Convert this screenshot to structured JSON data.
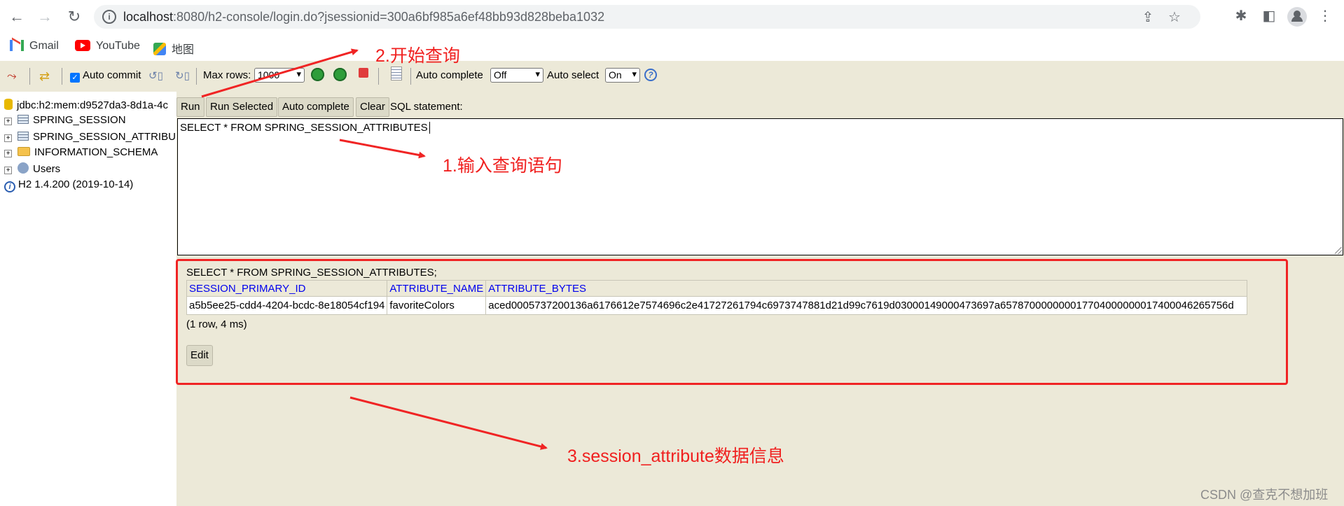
{
  "browser": {
    "url_host": "localhost",
    "url_rest": ":8080/h2-console/login.do?jsessionid=300a6bf985a6ef48bb93d828beba1032",
    "icons": [
      "back-icon",
      "forward-icon",
      "reload-icon",
      "info-icon",
      "share-icon",
      "star-icon",
      "extensions-icon",
      "sidebar-icon",
      "profile-icon",
      "menu-icon"
    ]
  },
  "bookmarks": [
    {
      "label": "Gmail",
      "icon": "gmail-icon"
    },
    {
      "label": "YouTube",
      "icon": "youtube-icon"
    },
    {
      "label": "地图",
      "icon": "maps-icon"
    }
  ],
  "toolbar": {
    "auto_commit_label": "Auto commit",
    "auto_commit_checked": true,
    "max_rows_label": "Max rows:",
    "max_rows_value": "1000",
    "auto_complete_label": "Auto complete",
    "auto_complete_value": "Off",
    "auto_select_label": "Auto select",
    "auto_select_value": "On",
    "help_glyph": "?"
  },
  "tree": {
    "connection": "jdbc:h2:mem:d9527da3-8d1a-4c",
    "items": [
      {
        "label": "SPRING_SESSION",
        "icon": "table-icon"
      },
      {
        "label": "SPRING_SESSION_ATTRIBU",
        "icon": "table-icon"
      },
      {
        "label": "INFORMATION_SCHEMA",
        "icon": "folder-icon"
      },
      {
        "label": "Users",
        "icon": "users-icon"
      }
    ],
    "version": "H2 1.4.200 (2019-10-14)"
  },
  "query_bar": {
    "run": "Run",
    "run_selected": "Run Selected",
    "auto_complete": "Auto complete",
    "clear": "Clear",
    "statement_label": "SQL statement:"
  },
  "sql": {
    "text": "SELECT * FROM SPRING_SESSION_ATTRIBUTES"
  },
  "result": {
    "statement": "SELECT * FROM SPRING_SESSION_ATTRIBUTES;",
    "columns": [
      "SESSION_PRIMARY_ID",
      "ATTRIBUTE_NAME",
      "ATTRIBUTE_BYTES"
    ],
    "rows": [
      [
        "a5b5ee25-cdd4-4204-bcdc-8e18054cf194",
        "favoriteColors",
        "aced0005737200136a6176612e7574696c2e41727261794c6973747881d21d99c7619d03000149000473697a657870000000017704000000017400046265756d"
      ]
    ],
    "meta": "(1 row, 4 ms)",
    "edit": "Edit"
  },
  "annotations": {
    "step1": "1.输入查询语句",
    "step2": "2.开始查询",
    "step3": "3.session_attribute数据信息",
    "color": "#f0201f"
  },
  "watermark": "CSDN @查克不想加班"
}
